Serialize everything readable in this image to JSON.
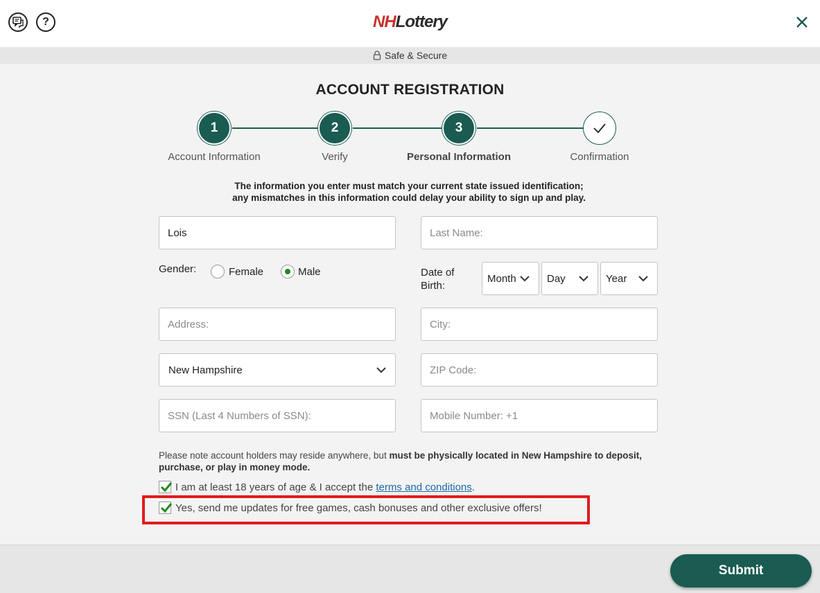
{
  "header": {
    "logo_nh": "NH",
    "logo_lottery": "Lottery",
    "help_label": "?",
    "secure_text": "Safe & Secure"
  },
  "title": "ACCOUNT REGISTRATION",
  "steps": [
    {
      "number": "1",
      "label": "Account Information",
      "state": "complete"
    },
    {
      "number": "2",
      "label": "Verify",
      "state": "complete"
    },
    {
      "number": "3",
      "label": "Personal Information",
      "state": "active"
    },
    {
      "number": "",
      "label": "Confirmation",
      "state": "check"
    }
  ],
  "notice": {
    "line1": "The information you enter must match your current state issued identification;",
    "line2": "any mismatches in this information could delay your ability to sign up and play."
  },
  "form": {
    "first_name_value": "Lois",
    "last_name_placeholder": "Last Name:",
    "gender_label": "Gender:",
    "gender_options": [
      "Female",
      "Male"
    ],
    "gender_selected": "Male",
    "dob_label_line1": "Date of",
    "dob_label_line2": "Birth:",
    "dob_month": "Month",
    "dob_day": "Day",
    "dob_year": "Year",
    "address_placeholder": "Address:",
    "city_placeholder": "City:",
    "state_value": "New Hampshire",
    "zip_placeholder": "ZIP Code:",
    "ssn_placeholder": "SSN (Last 4 Numbers of SSN):",
    "mobile_placeholder": "Mobile Number: +1"
  },
  "location_note": {
    "normal": "Please note account holders may reside anywhere, but ",
    "bold": "must be physically located in New Hampshire to deposit, purchase, or play in money mode."
  },
  "checks": {
    "age_text": "I am at least 18 years of age & I accept the ",
    "terms_link": "terms and conditions",
    "age_suffix": ".",
    "age_checked": true,
    "updates_text": "Yes, send me updates for free games, cash bonuses and other exclusive offers!",
    "updates_checked": true
  },
  "footer": {
    "submit_label": "Submit"
  },
  "colors": {
    "brand_green": "#1a5c52",
    "logo_red": "#c8312b",
    "highlight_red": "#e11b1b",
    "check_green": "#1f8a1f"
  }
}
